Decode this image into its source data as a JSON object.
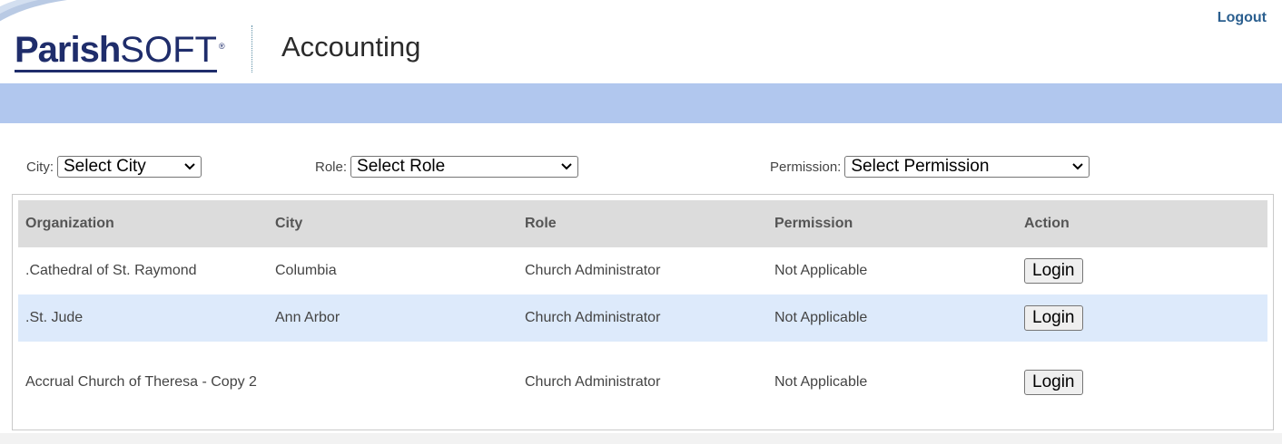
{
  "header": {
    "logo_parish": "Parish",
    "logo_soft": "SOFT",
    "logo_reg": "®",
    "app_name": "Accounting",
    "logout_label": "Logout"
  },
  "filters": {
    "city": {
      "label": "City:",
      "value": "Select City"
    },
    "role": {
      "label": "Role:",
      "value": "Select Role"
    },
    "permission": {
      "label": "Permission:",
      "value": "Select Permission"
    }
  },
  "table": {
    "columns": [
      "Organization",
      "City",
      "Role",
      "Permission",
      "Action"
    ],
    "rows": [
      {
        "organization": ".Cathedral of St. Raymond",
        "city": "Columbia",
        "role": "Church Administrator",
        "permission": "Not Applicable",
        "action": "Login"
      },
      {
        "organization": ".St. Jude",
        "city": "Ann Arbor",
        "role": "Church Administrator",
        "permission": "Not Applicable",
        "action": "Login"
      },
      {
        "organization": "Accrual Church of Theresa - Copy 2",
        "city": "",
        "role": "Church Administrator",
        "permission": "Not Applicable",
        "action": "Login"
      }
    ]
  },
  "colors": {
    "brand_navy": "#1f2d6b",
    "band_blue": "#b1c7ee",
    "alt_row": "#ddeafb",
    "header_row": "#dcdcdc",
    "logout_link": "#2b5f8f"
  }
}
